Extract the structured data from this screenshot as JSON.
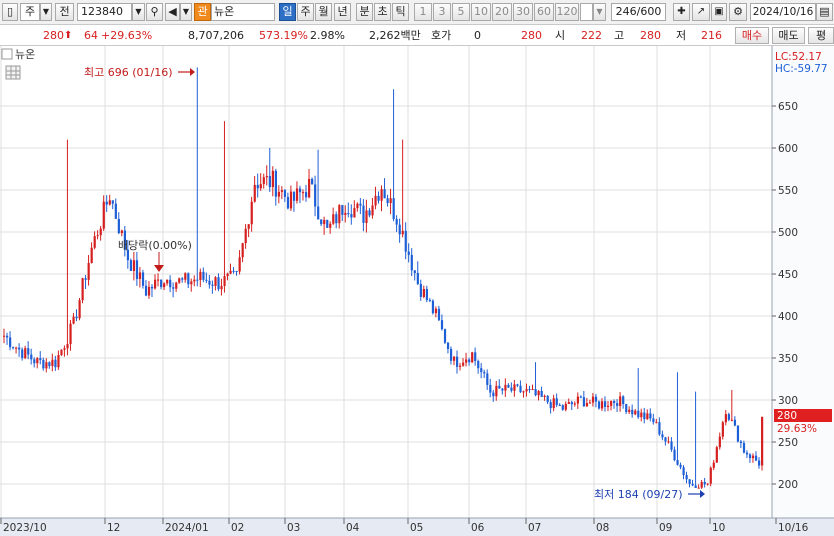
{
  "toolbar": {
    "market": "주",
    "type_btn": "전",
    "code": "123840",
    "tag": "관",
    "name": "뉴온",
    "periods": [
      "일",
      "주",
      "월",
      "년",
      "분",
      "초",
      "틱"
    ],
    "intervals": [
      "1",
      "3",
      "5",
      "10",
      "20",
      "30",
      "60",
      "120"
    ],
    "count": "246/600",
    "date": "2024/10/16"
  },
  "quote": {
    "price": "280",
    "change": "64",
    "change_pct": "+29.63%",
    "volume": "8,707,206",
    "volume_ratio": "573.19%",
    "turnover": "2.98%",
    "amount": "2,262백만",
    "hoga_label": "호가",
    "hoga_value": "0",
    "hoga_price": "280",
    "open_label": "시",
    "open": "222",
    "high_label": "고",
    "high": "280",
    "low_label": "저",
    "low": "216",
    "buy_label": "매수",
    "sell_label": "매도",
    "eval_label": "평"
  },
  "chart_title": "뉴온",
  "lc_label": "LC:52.17",
  "hc_label": "HC:-59.77",
  "annotations": {
    "high": "최고 696 (01/16)",
    "low": "최저 184 (09/27)",
    "dividend": "배당락(0.00%)"
  },
  "price_tag": {
    "value": "280",
    "pct": "29.63%"
  },
  "colors": {
    "up": "#d61f1f",
    "down": "#1d5fd6",
    "grid": "#dfdfdf",
    "axis_bg": "#e6eaf2"
  },
  "chart_data": {
    "type": "candlestick",
    "y_ticks": [
      200,
      250,
      300,
      350,
      400,
      450,
      500,
      550,
      600,
      650
    ],
    "ylim": [
      160,
      720
    ],
    "x_labels": [
      "2023/10",
      "12",
      "2024/01",
      "02",
      "03",
      "04",
      "05",
      "06",
      "07",
      "08",
      "09",
      "10",
      "10/16"
    ],
    "high_marker": {
      "value": 696,
      "date": "01/16"
    },
    "low_marker": {
      "value": 184,
      "date": "09/27"
    },
    "last": {
      "open": 222,
      "high": 280,
      "low": 216,
      "close": 280
    },
    "segments": [
      {
        "start": 380,
        "end": 360
      },
      {
        "start": 360,
        "end": 345
      },
      {
        "start": 345,
        "end": 345
      },
      {
        "start": 345,
        "end": 390
      },
      {
        "start": 390,
        "end": 480
      },
      {
        "start": 480,
        "end": 545
      },
      {
        "start": 545,
        "end": 470
      },
      {
        "start": 470,
        "end": 430
      },
      {
        "start": 430,
        "end": 445
      },
      {
        "start": 445,
        "end": 440
      },
      {
        "start": 440,
        "end": 445
      },
      {
        "start": 445,
        "end": 440
      },
      {
        "start": 440,
        "end": 445
      },
      {
        "start": 445,
        "end": 560
      },
      {
        "start": 560,
        "end": 560
      },
      {
        "start": 560,
        "end": 535
      },
      {
        "start": 535,
        "end": 555
      },
      {
        "start": 555,
        "end": 500
      },
      {
        "start": 500,
        "end": 535
      },
      {
        "start": 535,
        "end": 520
      },
      {
        "start": 520,
        "end": 555
      },
      {
        "start": 555,
        "end": 510
      },
      {
        "start": 510,
        "end": 440
      },
      {
        "start": 440,
        "end": 400
      },
      {
        "start": 400,
        "end": 345
      },
      {
        "start": 345,
        "end": 355
      },
      {
        "start": 355,
        "end": 310
      },
      {
        "start": 310,
        "end": 312
      },
      {
        "start": 312,
        "end": 310
      },
      {
        "start": 310,
        "end": 300
      },
      {
        "start": 300,
        "end": 290
      },
      {
        "start": 290,
        "end": 300
      },
      {
        "start": 300,
        "end": 295
      },
      {
        "start": 295,
        "end": 300
      },
      {
        "start": 300,
        "end": 285
      },
      {
        "start": 285,
        "end": 275
      },
      {
        "start": 275,
        "end": 240
      },
      {
        "start": 240,
        "end": 200
      },
      {
        "start": 200,
        "end": 200
      },
      {
        "start": 200,
        "end": 290
      },
      {
        "start": 290,
        "end": 240
      },
      {
        "start": 240,
        "end": 222
      }
    ],
    "spikes": [
      {
        "i": 21,
        "high": 610
      },
      {
        "i": 46,
        "high": 455
      },
      {
        "i": 64,
        "high": 696
      },
      {
        "i": 73,
        "high": 632
      },
      {
        "i": 88,
        "high": 600
      },
      {
        "i": 104,
        "high": 598
      },
      {
        "i": 129,
        "high": 670
      },
      {
        "i": 132,
        "high": 610
      },
      {
        "i": 137,
        "high": 465
      },
      {
        "i": 176,
        "high": 345
      },
      {
        "i": 210,
        "high": 338
      },
      {
        "i": 223,
        "high": 333
      },
      {
        "i": 241,
        "high": 312
      },
      {
        "i": 229,
        "high": 310
      }
    ]
  }
}
